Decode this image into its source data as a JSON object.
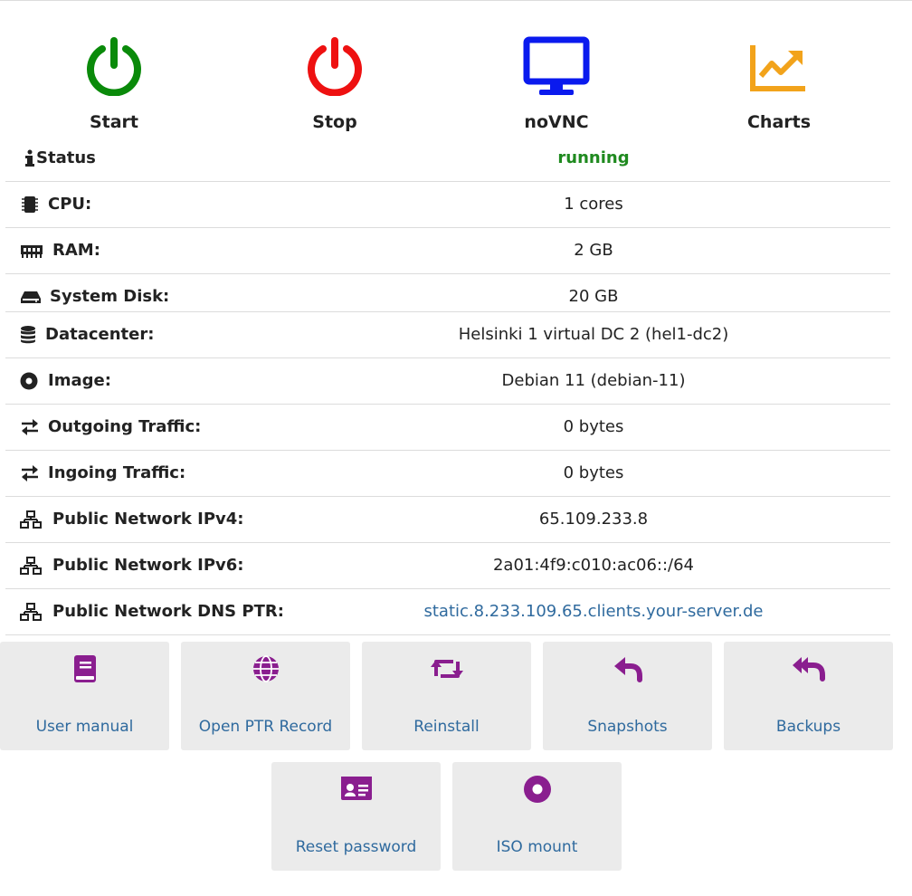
{
  "actions": [
    {
      "label": "Start",
      "icon": "power-icon",
      "color": "#0a8a0a"
    },
    {
      "label": "Stop",
      "icon": "power-icon",
      "color": "#ee1111"
    },
    {
      "label": "noVNC",
      "icon": "monitor-icon",
      "color": "#0a1aee"
    },
    {
      "label": "Charts",
      "icon": "chart-line-icon",
      "color": "#f2a31b"
    }
  ],
  "info": {
    "status": {
      "label": "Status",
      "value": "running",
      "icon": "info-icon"
    },
    "cpu": {
      "label": "CPU:",
      "value": "1 cores",
      "icon": "cpu-icon"
    },
    "ram": {
      "label": "RAM:",
      "value": "2 GB",
      "icon": "memory-icon"
    },
    "disk": {
      "label": "System Disk:",
      "value": "20 GB",
      "icon": "hdd-icon"
    },
    "datacenter": {
      "label": "Datacenter:",
      "value": "Helsinki 1 virtual DC 2 (hel1-dc2)",
      "icon": "database-icon"
    },
    "image": {
      "label": "Image:",
      "value": "Debian 11 (debian-11)",
      "icon": "disc-icon"
    },
    "outgoing": {
      "label": "Outgoing Traffic:",
      "value": "0 bytes",
      "icon": "exchange-icon"
    },
    "ingoing": {
      "label": "Ingoing Traffic:",
      "value": "0 bytes",
      "icon": "exchange-icon"
    },
    "ipv4": {
      "label": "Public Network IPv4:",
      "value": "65.109.233.8",
      "icon": "network-icon"
    },
    "ipv6": {
      "label": "Public Network IPv6:",
      "value": "2a01:4f9:c010:ac06::/64",
      "icon": "network-icon"
    },
    "ptr": {
      "label": "Public Network DNS PTR:",
      "value": "static.8.233.109.65.clients.your-server.de",
      "icon": "network-icon"
    }
  },
  "tiles": [
    {
      "label": "User manual",
      "icon": "book-icon"
    },
    {
      "label": "Open PTR Record",
      "icon": "globe-icon"
    },
    {
      "label": "Reinstall",
      "icon": "retweet-icon"
    },
    {
      "label": "Snapshots",
      "icon": "reply-icon"
    },
    {
      "label": "Backups",
      "icon": "reply-all-icon"
    },
    {
      "label": "Reset password",
      "icon": "id-card-icon"
    },
    {
      "label": "ISO mount",
      "icon": "disc-icon"
    }
  ],
  "colors": {
    "tile_icon": "#8a1e8f",
    "link": "#2f6a9e",
    "status_running": "#1f8a1f"
  }
}
